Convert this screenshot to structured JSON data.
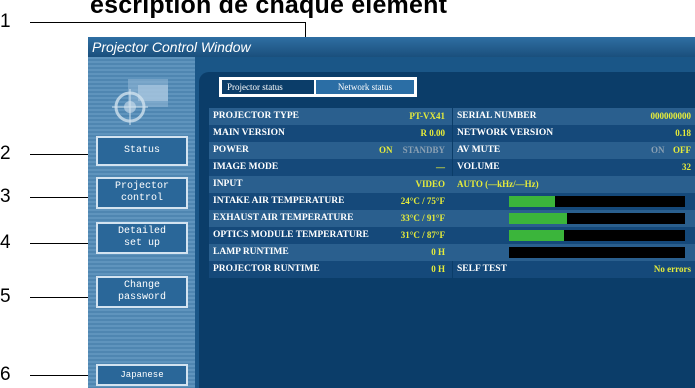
{
  "heading": "escription de chaque élément",
  "callouts": [
    "1",
    "2",
    "3",
    "4",
    "5",
    "6"
  ],
  "window": {
    "title": "Projector Control Window"
  },
  "sidebar": {
    "buttons": [
      {
        "line1": "Status",
        "line2": ""
      },
      {
        "line1": "Projector",
        "line2": "control"
      },
      {
        "line1": "Detailed",
        "line2": "set up"
      },
      {
        "line1": "Change",
        "line2": "password"
      },
      {
        "line1": "Japanese",
        "line2": ""
      }
    ]
  },
  "tabs": {
    "active": "Projector status",
    "inactive": "Network status"
  },
  "status": {
    "rows": [
      {
        "label": "PROJECTOR TYPE",
        "value": "PT-VX41",
        "label2": "SERIAL NUMBER",
        "value2": "000000000"
      },
      {
        "label": "MAIN VERSION",
        "value": "R 0.00",
        "label2": "NETWORK VERSION",
        "value2": "0.18"
      },
      {
        "label": "POWER",
        "on": "ON",
        "off": "STANDBY",
        "label2": "AV MUTE",
        "on2": "ON",
        "off2": "OFF"
      },
      {
        "label": "IMAGE MODE",
        "value": "—",
        "label2": "VOLUME",
        "value2": "32"
      },
      {
        "label": "INPUT",
        "value": "VIDEO",
        "extra": "AUTO (—kHz/—Hz)"
      },
      {
        "label": "INTAKE AIR TEMPERATURE",
        "value": "24°C / 75°F",
        "level": 0.26
      },
      {
        "label": "EXHAUST AIR TEMPERATURE",
        "value": "33°C / 91°F",
        "level": 0.33
      },
      {
        "label": "OPTICS MODULE TEMPERATURE",
        "value": "31°C / 87°F",
        "level": 0.31
      },
      {
        "label": "LAMP RUNTIME",
        "value": "0 H",
        "level": 0
      },
      {
        "label": "PROJECTOR RUNTIME",
        "value": "0 H",
        "label2": "SELF TEST",
        "value2": "No errors"
      }
    ]
  },
  "colors": {
    "accent_value": "#e6ec3a",
    "bar_fill": "#3bb53b",
    "window_bg": "#1d5e8e"
  }
}
